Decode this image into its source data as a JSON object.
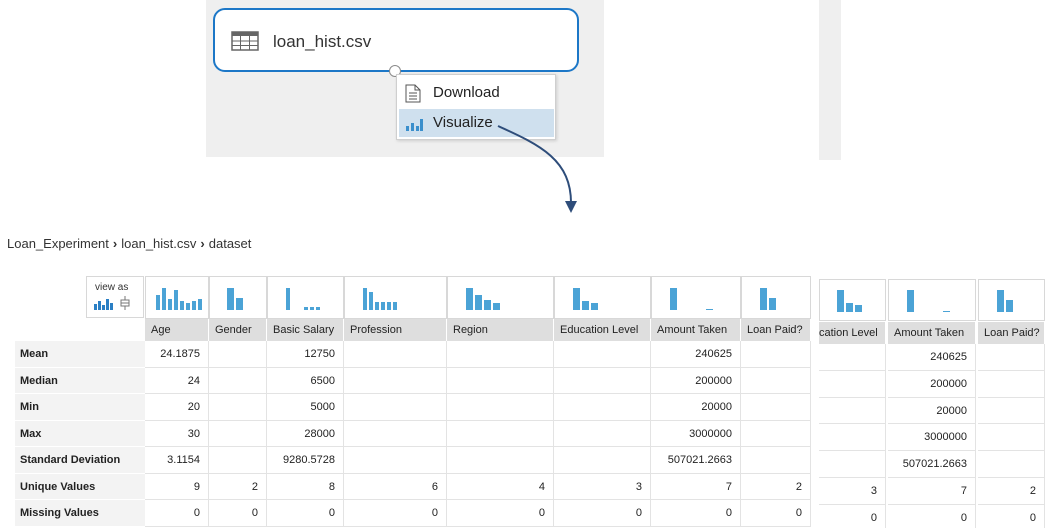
{
  "module": {
    "name": "loan_hist.csv"
  },
  "context_menu": {
    "items": [
      "Download",
      "Visualize"
    ]
  },
  "breadcrumb": {
    "items": [
      "Loan_Experiment",
      "loan_hist.csv",
      "dataset"
    ]
  },
  "view_as_label": "view as",
  "colors": {
    "accent": "#1c77c7",
    "bar": "#4ba3d6",
    "selected": "#cfe0ee",
    "header": "#dedede"
  },
  "table": {
    "columns": [
      "Age",
      "Gender",
      "Basic Salary",
      "Profession",
      "Region",
      "Education Level",
      "Amount Taken",
      "Loan Paid?"
    ],
    "rows": [
      {
        "label": "Mean",
        "values": [
          "24.1875",
          "",
          "12750",
          "",
          "",
          "",
          "240625",
          ""
        ]
      },
      {
        "label": "Median",
        "values": [
          "24",
          "",
          "6500",
          "",
          "",
          "",
          "200000",
          ""
        ]
      },
      {
        "label": "Min",
        "values": [
          "20",
          "",
          "5000",
          "",
          "",
          "",
          "20000",
          ""
        ]
      },
      {
        "label": "Max",
        "values": [
          "30",
          "",
          "28000",
          "",
          "",
          "",
          "3000000",
          ""
        ]
      },
      {
        "label": "Standard Deviation",
        "values": [
          "3.1154",
          "",
          "9280.5728",
          "",
          "",
          "",
          "507021.2663",
          ""
        ]
      },
      {
        "label": "Unique Values",
        "values": [
          "9",
          "2",
          "8",
          "6",
          "4",
          "3",
          "7",
          "2"
        ]
      },
      {
        "label": "Missing Values",
        "values": [
          "0",
          "0",
          "0",
          "0",
          "0",
          "0",
          "0",
          "0"
        ]
      }
    ],
    "histograms": [
      [
        0.7,
        1.0,
        0.5,
        0.9,
        0.4,
        0.3,
        0.4,
        0.5
      ],
      [
        1.0,
        0.55
      ],
      [
        1.0,
        0.0,
        0.0,
        0.15,
        0.15,
        0.15
      ],
      [
        1.0,
        0.8,
        0.35,
        0.35,
        0.35,
        0.35
      ],
      [
        1.0,
        0.7,
        0.45,
        0.3
      ],
      [
        1.0,
        0.4,
        0.3
      ],
      [
        1.0,
        0.0,
        0.0,
        0.0,
        0.05
      ],
      [
        1.0,
        0.55
      ]
    ]
  },
  "side_table": {
    "columns": [
      "Education Level",
      "Amount Taken",
      "Loan Paid?"
    ],
    "header_labels": [
      "cation Level",
      "Amount Taken",
      "Loan Paid?"
    ],
    "rows": [
      [
        "",
        "240625",
        ""
      ],
      [
        "",
        "200000",
        ""
      ],
      [
        "",
        "20000",
        ""
      ],
      [
        "",
        "3000000",
        ""
      ],
      [
        "",
        "507021.2663",
        ""
      ],
      [
        "3",
        "7",
        "2"
      ],
      [
        "0",
        "0",
        "0"
      ]
    ]
  }
}
